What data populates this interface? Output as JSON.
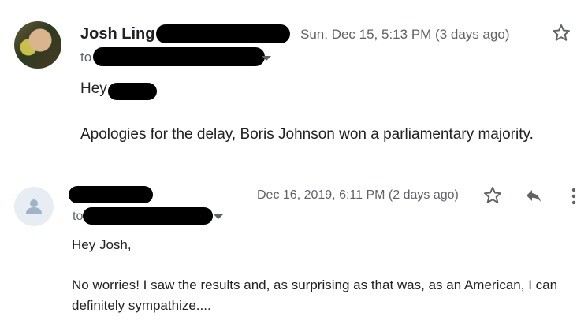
{
  "message1": {
    "sender_name": "Josh Ling",
    "timestamp": "Sun, Dec 15, 5:13 PM (3 days ago)",
    "to_label": "to",
    "greeting": "Hey",
    "body": "Apologies for the delay, Boris Johnson won a parliamentary majority."
  },
  "message2": {
    "timestamp": "Dec 16, 2019, 6:11 PM (2 days ago)",
    "to_label": "to",
    "greeting": "Hey Josh,",
    "body_line1": "No worries! I saw the results and, as surprising as that was, as an American, I can",
    "body_line2": "definitely sympathize...."
  },
  "icons": {
    "star": "star-icon",
    "reply": "reply-icon",
    "more": "more-vert-icon",
    "caret": "chevron-down-icon"
  }
}
